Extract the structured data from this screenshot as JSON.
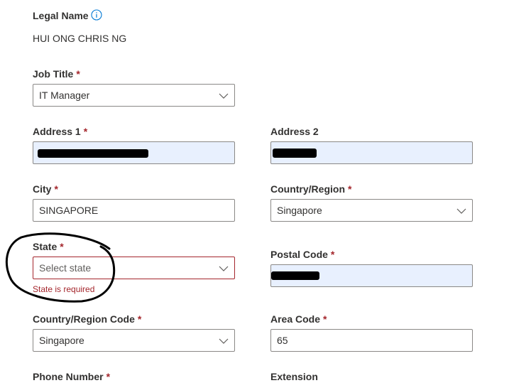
{
  "legal_name": {
    "label": "Legal Name",
    "value": "HUI ONG CHRIS NG"
  },
  "required_marker": "*",
  "job_title": {
    "label": "Job Title",
    "value": "IT Manager"
  },
  "address1": {
    "label": "Address 1"
  },
  "address2": {
    "label": "Address 2"
  },
  "city": {
    "label": "City",
    "value": "SINGAPORE"
  },
  "country_region": {
    "label": "Country/Region",
    "value": "Singapore"
  },
  "state": {
    "label": "State",
    "placeholder": "Select state",
    "error": "State is required"
  },
  "postal_code": {
    "label": "Postal Code"
  },
  "country_region_code": {
    "label": "Country/Region Code",
    "value": "Singapore"
  },
  "area_code": {
    "label": "Area Code",
    "value": "65"
  },
  "phone_number": {
    "label": "Phone Number"
  },
  "extension": {
    "label": "Extension"
  },
  "colors": {
    "error": "#a4262c",
    "autofill": "#e8f0fe",
    "info": "#0078d4"
  }
}
